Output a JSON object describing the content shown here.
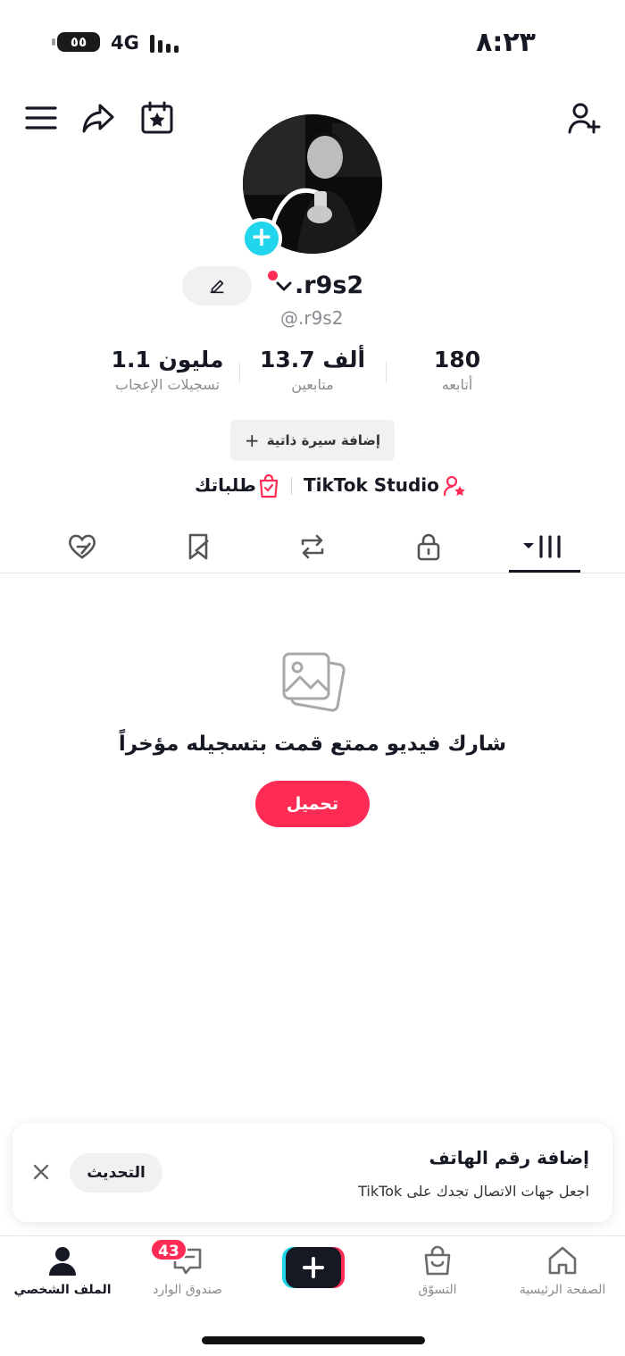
{
  "status_bar": {
    "time": "٨:٢٣",
    "battery_label": "٥٥",
    "network": "4G"
  },
  "header": {
    "menu_icon": "menu-icon",
    "share_icon": "share-icon",
    "calendar_icon": "calendar-star-icon",
    "add_friend_icon": "add-user-icon"
  },
  "profile": {
    "display_name": ".r9s2",
    "handle": "@.r9s2",
    "stats": [
      {
        "value": "180",
        "label": "أتابعه"
      },
      {
        "value": "13.7 ألف",
        "label": "متابعين"
      },
      {
        "value": "1.1 مليون",
        "label": "تسجيلات الإعجاب"
      }
    ],
    "add_bio_label": "إضافة سيرة ذاتية",
    "studio_label": "TikTok Studio",
    "orders_label": "طلباتك"
  },
  "tabs": [
    "videos",
    "private",
    "reposts",
    "favorites",
    "liked"
  ],
  "empty_state": {
    "title": "شارك فيديو ممتع قمت بتسجيله مؤخراً",
    "upload_label": "تحميل"
  },
  "phone_card": {
    "title": "إضافة رقم الهاتف",
    "subtitle": "اجعل جهات الاتصال تجدك على TikTok",
    "update_label": "التحديث"
  },
  "bottom_nav": {
    "home": "الصفحة الرئيسية",
    "shop": "التسوّق",
    "inbox": "صندوق الوارد",
    "inbox_badge": "43",
    "profile": "الملف الشخصي"
  },
  "colors": {
    "accent": "#fe2c55",
    "cyan": "#20d5ec",
    "text": "#161823",
    "muted": "#8a8b91"
  }
}
